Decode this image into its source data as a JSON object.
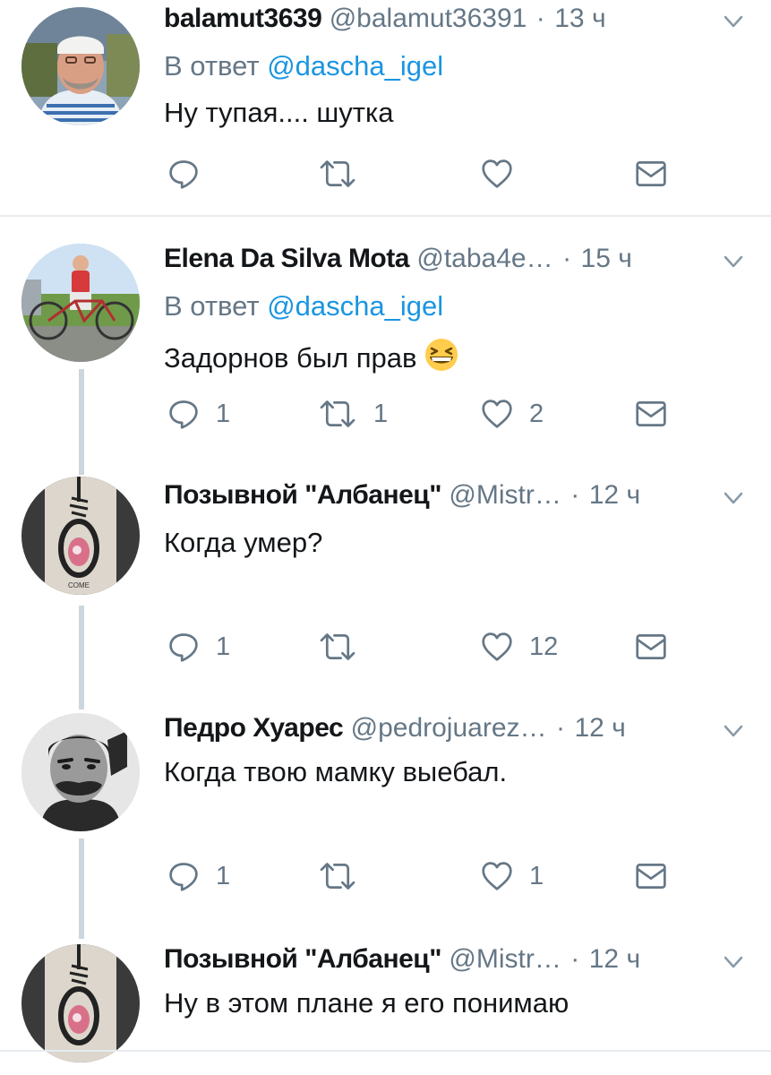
{
  "icons": {
    "reply": "reply-icon",
    "retweet": "retweet-icon",
    "like": "heart-icon",
    "dm": "envelope-icon",
    "caret": "chevron-down-icon"
  },
  "colors": {
    "name": "#14171a",
    "meta": "#657786",
    "mention": "#1b95e0",
    "thread_line": "#ccd6dd",
    "divider": "#e6ecf0"
  },
  "tweets": [
    {
      "name": "balamut3639",
      "handle": "@balamut36391",
      "time": "13 ч",
      "reply_prefix": "В ответ",
      "reply_to": "@dascha_igel",
      "text": "Ну тупая.... шутка",
      "replies": "",
      "retweets": "",
      "likes": ""
    },
    {
      "name": "Elena Da Silva Mota",
      "handle": "@taba4e…",
      "time": "15 ч",
      "reply_prefix": "В ответ",
      "reply_to": "@dascha_igel",
      "text": "Задорнов был прав",
      "emoji": "grinning-squinting-face",
      "replies": "1",
      "retweets": "1",
      "likes": "2"
    },
    {
      "name": "Позывной \"Албанец\"",
      "handle": "@Mistr…",
      "time": "12 ч",
      "text": "Когда умер?",
      "replies": "1",
      "retweets": "",
      "likes": "12"
    },
    {
      "name": "Педро Хуарес",
      "handle": "@pedrojuarez…",
      "time": "12 ч",
      "text": "Когда твою мамку выебал.",
      "replies": "1",
      "retweets": "",
      "likes": "1"
    },
    {
      "name": "Позывной \"Албанец\"",
      "handle": "@Mistr…",
      "time": "12 ч",
      "text": "Ну в этом плане я его понимаю"
    }
  ]
}
